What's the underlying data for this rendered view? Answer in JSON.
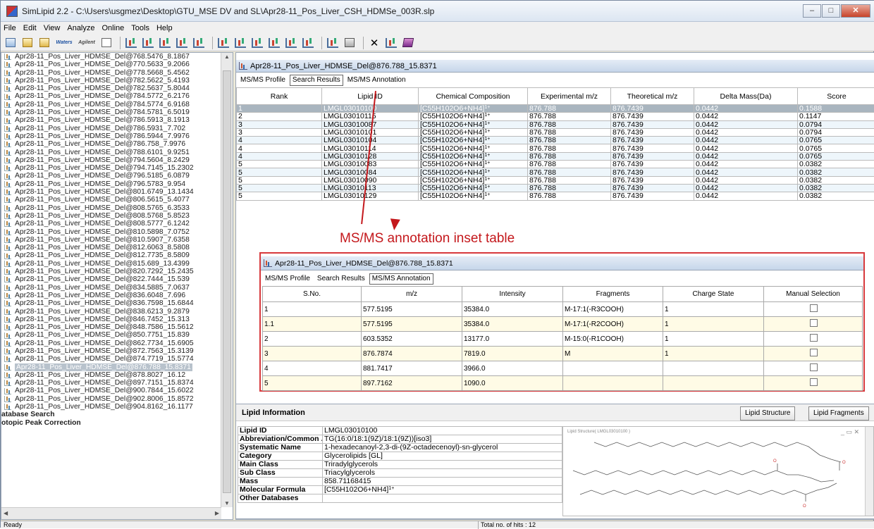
{
  "window": {
    "title": "SimLipid 2.2 - C:\\Users\\usgmez\\Desktop\\GTU_MSE DV and SL\\Apr28-11_Pos_Liver_CSH_HDMSe_003R.slp",
    "minimize": "–",
    "maximize": "□",
    "close": "✕"
  },
  "menu": [
    "File",
    "Edit",
    "View",
    "Analyze",
    "Online",
    "Tools",
    "Help"
  ],
  "toolbar": {
    "waters_label": "Waters",
    "agilent_label": "Agilent",
    "x_glyph": "✕"
  },
  "tree": {
    "items": [
      "Apr28-11_Pos_Liver_HDMSE_Del@768.5476_8.1867",
      "Apr28-11_Pos_Liver_HDMSE_Del@770.5633_9.2066",
      "Apr28-11_Pos_Liver_HDMSE_Del@778.5668_5.4562",
      "Apr28-11_Pos_Liver_HDMSE_Del@782.5622_5.4193",
      "Apr28-11_Pos_Liver_HDMSE_Del@782.5637_5.8044",
      "Apr28-11_Pos_Liver_HDMSE_Del@784.5772_6.2176",
      "Apr28-11_Pos_Liver_HDMSE_Del@784.5774_6.9168",
      "Apr28-11_Pos_Liver_HDMSE_Del@784.5781_6.5019",
      "Apr28-11_Pos_Liver_HDMSE_Del@786.5913_8.1913",
      "Apr28-11_Pos_Liver_HDMSE_Del@786.5931_7.702",
      "Apr28-11_Pos_Liver_HDMSE_Del@786.5944_7.9976",
      "Apr28-11_Pos_Liver_HDMSE_Del@786.758_7.9976",
      "Apr28-11_Pos_Liver_HDMSE_Del@788.6101_9.9251",
      "Apr28-11_Pos_Liver_HDMSE_Del@794.5604_8.2429",
      "Apr28-11_Pos_Liver_HDMSE_Del@794.7145_15.2302",
      "Apr28-11_Pos_Liver_HDMSE_Del@796.5185_6.0879",
      "Apr28-11_Pos_Liver_HDMSE_Del@796.5783_9.954",
      "Apr28-11_Pos_Liver_HDMSE_Del@801.6749_13.1434",
      "Apr28-11_Pos_Liver_HDMSE_Del@806.5615_5.4077",
      "Apr28-11_Pos_Liver_HDMSE_Del@808.5765_6.3533",
      "Apr28-11_Pos_Liver_HDMSE_Del@808.5768_5.8523",
      "Apr28-11_Pos_Liver_HDMSE_Del@808.5777_6.1242",
      "Apr28-11_Pos_Liver_HDMSE_Del@810.5898_7.0752",
      "Apr28-11_Pos_Liver_HDMSE_Del@810.5907_7.6358",
      "Apr28-11_Pos_Liver_HDMSE_Del@812.6063_8.5808",
      "Apr28-11_Pos_Liver_HDMSE_Del@812.7735_8.5809",
      "Apr28-11_Pos_Liver_HDMSE_Del@815.689_13.4399",
      "Apr28-11_Pos_Liver_HDMSE_Del@820.7292_15.2435",
      "Apr28-11_Pos_Liver_HDMSE_Del@822.7444_15.539",
      "Apr28-11_Pos_Liver_HDMSE_Del@834.5885_7.0637",
      "Apr28-11_Pos_Liver_HDMSE_Del@836.6048_7.696",
      "Apr28-11_Pos_Liver_HDMSE_Del@836.7598_15.6844",
      "Apr28-11_Pos_Liver_HDMSE_Del@838.6213_9.2879",
      "Apr28-11_Pos_Liver_HDMSE_Del@846.7452_15.313",
      "Apr28-11_Pos_Liver_HDMSE_Del@848.7586_15.5612",
      "Apr28-11_Pos_Liver_HDMSE_Del@850.7751_15.839",
      "Apr28-11_Pos_Liver_HDMSE_Del@862.7734_15.6905",
      "Apr28-11_Pos_Liver_HDMSE_Del@872.7563_15.3139",
      "Apr28-11_Pos_Liver_HDMSE_Del@874.7719_15.5774",
      "Apr28-11_Pos_Liver_HDMSE_Del@876.788_15.8371",
      "Apr28-11_Pos_Liver_HDMSE_Del@878.8027_16.12",
      "Apr28-11_Pos_Liver_HDMSE_Del@897.7151_15.8374",
      "Apr28-11_Pos_Liver_HDMSE_Del@900.7844_15.6022",
      "Apr28-11_Pos_Liver_HDMSE_Del@902.8006_15.8572",
      "Apr28-11_Pos_Liver_HDMSE_Del@904.8162_16.1177"
    ],
    "selected_index": 39,
    "nodes": [
      "atabase Search",
      "otopic Peak Correction"
    ]
  },
  "results_panel": {
    "title": "Apr28-11_Pos_Liver_HDMSE_Del@876.788_15.8371",
    "tabs": [
      "MS/MS Profile",
      "Search Results",
      "MS/MS Annotation"
    ],
    "active_tab": 1,
    "columns": [
      "Rank",
      "Lipid ID",
      "Chemical Composition",
      "Experimental m/z",
      "Theoretical m/z",
      "Delta Mass(Da)",
      "Score"
    ],
    "rows": [
      {
        "rank": "1",
        "id": "LMGL03010100",
        "comp": "[C55H102O6+NH4]",
        "charge": "1+",
        "exp": "876.788",
        "theo": "876.7439",
        "delta": "0.0442",
        "score": "0.1588"
      },
      {
        "rank": "2",
        "id": "LMGL03010115",
        "comp": "[C55H102O6+NH4]",
        "charge": "1+",
        "exp": "876.788",
        "theo": "876.7439",
        "delta": "0.0442",
        "score": "0.1147"
      },
      {
        "rank": "3",
        "id": "LMGL03010087",
        "comp": "[C55H102O6+NH4]",
        "charge": "1+",
        "exp": "876.788",
        "theo": "876.7439",
        "delta": "0.0442",
        "score": "0.0794"
      },
      {
        "rank": "3",
        "id": "LMGL03010101",
        "comp": "[C55H102O6+NH4]",
        "charge": "1+",
        "exp": "876.788",
        "theo": "876.7439",
        "delta": "0.0442",
        "score": "0.0794"
      },
      {
        "rank": "4",
        "id": "LMGL03010104",
        "comp": "[C55H102O6+NH4]",
        "charge": "1+",
        "exp": "876.788",
        "theo": "876.7439",
        "delta": "0.0442",
        "score": "0.0765"
      },
      {
        "rank": "4",
        "id": "LMGL03010114",
        "comp": "[C55H102O6+NH4]",
        "charge": "1+",
        "exp": "876.788",
        "theo": "876.7439",
        "delta": "0.0442",
        "score": "0.0765"
      },
      {
        "rank": "4",
        "id": "LMGL03010128",
        "comp": "[C55H102O6+NH4]",
        "charge": "1+",
        "exp": "876.788",
        "theo": "876.7439",
        "delta": "0.0442",
        "score": "0.0765"
      },
      {
        "rank": "5",
        "id": "LMGL03010083",
        "comp": "[C55H102O6+NH4]",
        "charge": "1+",
        "exp": "876.788",
        "theo": "876.7439",
        "delta": "0.0442",
        "score": "0.0382"
      },
      {
        "rank": "5",
        "id": "LMGL03010084",
        "comp": "[C55H102O6+NH4]",
        "charge": "1+",
        "exp": "876.788",
        "theo": "876.7439",
        "delta": "0.0442",
        "score": "0.0382"
      },
      {
        "rank": "5",
        "id": "LMGL03010090",
        "comp": "[C55H102O6+NH4]",
        "charge": "1+",
        "exp": "876.788",
        "theo": "876.7439",
        "delta": "0.0442",
        "score": "0.0382"
      },
      {
        "rank": "5",
        "id": "LMGL03010113",
        "comp": "[C55H102O6+NH4]",
        "charge": "1+",
        "exp": "876.788",
        "theo": "876.7439",
        "delta": "0.0442",
        "score": "0.0382"
      },
      {
        "rank": "5",
        "id": "LMGL03010129",
        "comp": "[C55H102O6+NH4]",
        "charge": "1+",
        "exp": "876.788",
        "theo": "876.7439",
        "delta": "0.0442",
        "score": "0.0382"
      }
    ]
  },
  "annotation_callout": {
    "text": "MS/MS annotation inset table",
    "color": "#c4181c"
  },
  "inset": {
    "title": "Apr28-11_Pos_Liver_HDMSE_Del@876.788_15.8371",
    "tabs": [
      "MS/MS Profile",
      "Search Results",
      "MS/MS Annotation"
    ],
    "active_tab": 2,
    "columns": [
      "S.No.",
      "m/z",
      "Intensity",
      "Fragments",
      "Charge State",
      "Manual Selection"
    ],
    "rows": [
      {
        "sno": "1",
        "mz": "577.5195",
        "intensity": "35384.0",
        "fragment": "M-17:1(-R3COOH)",
        "charge": "1"
      },
      {
        "sno": "1.1",
        "mz": "577.5195",
        "intensity": "35384.0",
        "fragment": "M-17:1(-R2COOH)",
        "charge": "1"
      },
      {
        "sno": "2",
        "mz": "603.5352",
        "intensity": "13177.0",
        "fragment": "M-15:0(-R1COOH)",
        "charge": "1"
      },
      {
        "sno": "3",
        "mz": "876.7874",
        "intensity": "7819.0",
        "fragment": "M",
        "charge": "1"
      },
      {
        "sno": "4",
        "mz": "881.7417",
        "intensity": "3966.0",
        "fragment": "",
        "charge": ""
      },
      {
        "sno": "5",
        "mz": "897.7162",
        "intensity": "1090.0",
        "fragment": "",
        "charge": ""
      }
    ]
  },
  "lipid_info": {
    "title": "Lipid Information",
    "buttons": [
      "Lipid Structure",
      "Lipid Fragments"
    ],
    "rows": [
      {
        "key": "Lipid ID",
        "value": "LMGL03010100"
      },
      {
        "key": "Abbreviation/Common ...",
        "value": "TG(16:0/18:1(9Z)/18:1(9Z))[iso3]"
      },
      {
        "key": "Systematic Name",
        "value": "1-hexadecanoyl-2,3-di-(9Z-octadecenoyl)-sn-glycerol"
      },
      {
        "key": "Category",
        "value": "Glycerolipids [GL]"
      },
      {
        "key": "Main Class",
        "value": "Triradylglycerols"
      },
      {
        "key": "Sub Class",
        "value": "Triacylglycerols"
      },
      {
        "key": "Mass",
        "value": "858.71168415"
      },
      {
        "key": "Molecular Formula",
        "value": "[C55H102O6+NH4]",
        "sup": "1+"
      },
      {
        "key": "Other Databases",
        "value": ""
      }
    ],
    "structure_caption": "Lipid Structure( LMGL03010100 )"
  },
  "status": {
    "left": "Ready",
    "hits": "Total no. of hits : 12"
  }
}
